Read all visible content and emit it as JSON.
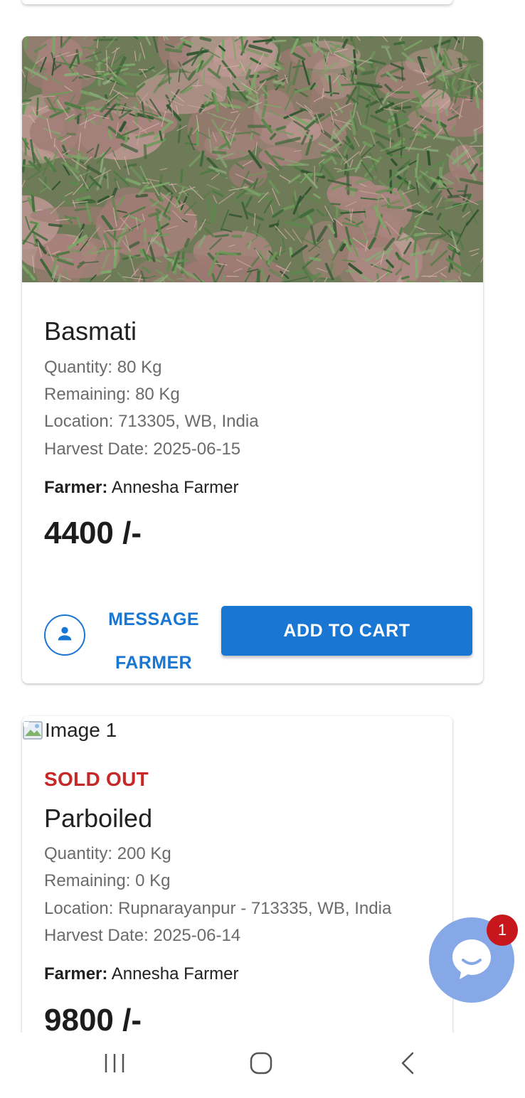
{
  "listings": [
    {
      "image_alt": "",
      "name": "Basmati",
      "quantity": "Quantity: 80 Kg",
      "remaining": "Remaining: 80 Kg",
      "location": "Location: 713305, WB, India",
      "harvest_date": "Harvest Date: 2025-06-15",
      "farmer_label": "Farmer:",
      "farmer_name": "Annesha Farmer",
      "price": "4400 /-",
      "message_button": "MESSAGE FARMER",
      "cart_button": "ADD TO CART"
    },
    {
      "image_alt": "Image 1",
      "status": "SOLD OUT",
      "name": "Parboiled",
      "quantity": "Quantity: 200 Kg",
      "remaining": "Remaining: 0 Kg",
      "location": "Location: Rupnarayanpur - 713335, WB, India",
      "harvest_date": "Harvest Date: 2025-06-14",
      "farmer_label": "Farmer:",
      "farmer_name": "Annesha Farmer",
      "price": "9800 /-"
    }
  ],
  "chat": {
    "icon": "chat-bubble-icon",
    "unread_count": "1"
  },
  "nav": {
    "recent_icon": "recent-apps-icon",
    "home_icon": "home-icon",
    "back_icon": "back-icon"
  },
  "colors": {
    "primary": "#1976d2",
    "sold_out": "#c62828",
    "badge": "#c8161d",
    "chat_fab": "#86a8e6"
  }
}
